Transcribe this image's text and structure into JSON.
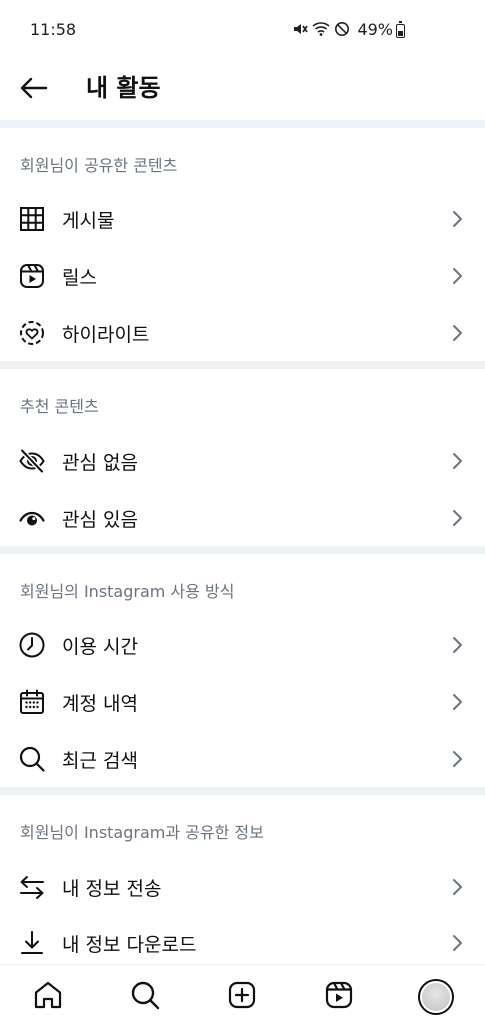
{
  "status_bar": {
    "time": "11:58",
    "battery": "49%"
  },
  "header": {
    "title": "내 활동"
  },
  "sections": [
    {
      "title": "회원님이 공유한 콘텐츠",
      "items": [
        {
          "label": "게시물",
          "icon": "grid-icon"
        },
        {
          "label": "릴스",
          "icon": "reels-icon"
        },
        {
          "label": "하이라이트",
          "icon": "highlight-icon"
        }
      ]
    },
    {
      "title": "추천 콘텐츠",
      "items": [
        {
          "label": "관심 없음",
          "icon": "eye-off-icon"
        },
        {
          "label": "관심 있음",
          "icon": "eye-icon"
        }
      ]
    },
    {
      "title": "회원님의 Instagram 사용 방식",
      "items": [
        {
          "label": "이용 시간",
          "icon": "clock-icon"
        },
        {
          "label": "계정 내역",
          "icon": "calendar-icon"
        },
        {
          "label": "최근 검색",
          "icon": "search-icon"
        }
      ]
    },
    {
      "title": "회원님이 Instagram과 공유한 정보",
      "items": [
        {
          "label": "내 정보 전송",
          "icon": "transfer-icon"
        },
        {
          "label": "내 정보 다운로드",
          "icon": "download-icon"
        }
      ]
    }
  ],
  "bottom_nav": [
    {
      "icon": "home-icon"
    },
    {
      "icon": "search-icon"
    },
    {
      "icon": "create-icon"
    },
    {
      "icon": "reels-icon"
    },
    {
      "icon": "profile-avatar"
    }
  ]
}
